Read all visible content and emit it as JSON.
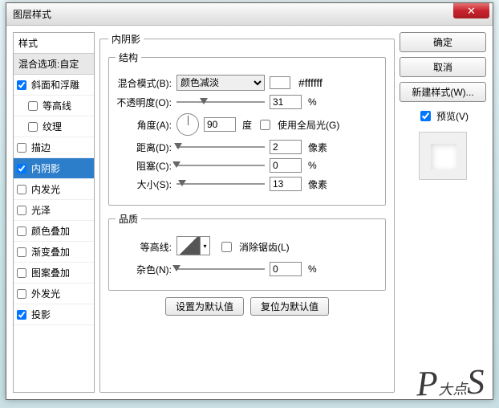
{
  "window": {
    "title": "图层样式"
  },
  "sidebar": {
    "header": "样式",
    "blend_options": "混合选项:自定",
    "items": [
      {
        "label": "斜面和浮雕",
        "checked": true
      },
      {
        "label": "等高线",
        "checked": false,
        "indent": true
      },
      {
        "label": "纹理",
        "checked": false,
        "indent": true
      },
      {
        "label": "描边",
        "checked": false
      },
      {
        "label": "内阴影",
        "checked": true,
        "selected": true
      },
      {
        "label": "内发光",
        "checked": false
      },
      {
        "label": "光泽",
        "checked": false
      },
      {
        "label": "颜色叠加",
        "checked": false
      },
      {
        "label": "渐变叠加",
        "checked": false
      },
      {
        "label": "图案叠加",
        "checked": false
      },
      {
        "label": "外发光",
        "checked": false
      },
      {
        "label": "投影",
        "checked": true
      }
    ]
  },
  "panel": {
    "title": "内阴影",
    "structure": {
      "legend": "结构",
      "blend_mode_label": "混合模式(B):",
      "blend_mode_value": "颜色减淡",
      "hex": "#ffffff",
      "opacity_label": "不透明度(O):",
      "opacity_value": "31",
      "opacity_unit": "%",
      "angle_label": "角度(A):",
      "angle_value": "90",
      "angle_unit": "度",
      "global_light_label": "使用全局光(G)",
      "distance_label": "距离(D):",
      "distance_value": "2",
      "distance_unit": "像素",
      "choke_label": "阻塞(C):",
      "choke_value": "0",
      "choke_unit": "%",
      "size_label": "大小(S):",
      "size_value": "13",
      "size_unit": "像素"
    },
    "quality": {
      "legend": "品质",
      "contour_label": "等高线:",
      "antialias_label": "消除锯齿(L)",
      "noise_label": "杂色(N):",
      "noise_value": "0",
      "noise_unit": "%"
    },
    "defaults": {
      "make": "设置为默认值",
      "reset": "复位为默认值"
    }
  },
  "right": {
    "ok": "确定",
    "cancel": "取消",
    "new_style": "新建样式(W)...",
    "preview": "预览(V)"
  },
  "watermark": "P大点S"
}
